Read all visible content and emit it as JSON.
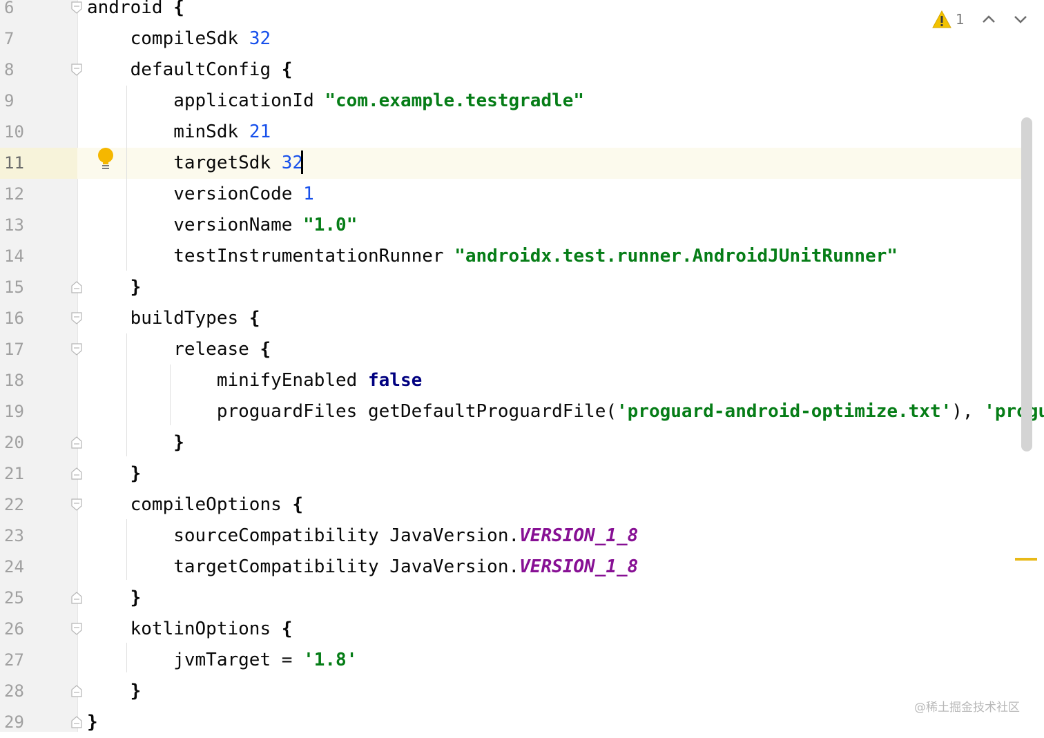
{
  "editor": {
    "lines": [
      {
        "n": "6",
        "fold": "open",
        "tokens": [
          {
            "t": "android ",
            "c": ""
          },
          {
            "t": "{",
            "c": "brace"
          }
        ]
      },
      {
        "n": "7",
        "fold": "",
        "tokens": [
          {
            "t": "    compileSdk ",
            "c": ""
          },
          {
            "t": "32",
            "c": "num"
          }
        ]
      },
      {
        "n": "8",
        "fold": "open",
        "tokens": [
          {
            "t": "    defaultConfig ",
            "c": ""
          },
          {
            "t": "{",
            "c": "brace"
          }
        ]
      },
      {
        "n": "9",
        "fold": "",
        "tokens": [
          {
            "t": "        applicationId ",
            "c": ""
          },
          {
            "t": "\"com.example.testgradle\"",
            "c": "str"
          }
        ]
      },
      {
        "n": "10",
        "fold": "",
        "tokens": [
          {
            "t": "        minSdk ",
            "c": ""
          },
          {
            "t": "21",
            "c": "num"
          }
        ]
      },
      {
        "n": "11",
        "fold": "",
        "current": true,
        "tokens": [
          {
            "t": "        targetSdk ",
            "c": ""
          },
          {
            "t": "32",
            "c": "num"
          }
        ]
      },
      {
        "n": "12",
        "fold": "",
        "tokens": [
          {
            "t": "        versionCode ",
            "c": ""
          },
          {
            "t": "1",
            "c": "num"
          }
        ]
      },
      {
        "n": "13",
        "fold": "",
        "tokens": [
          {
            "t": "        versionName ",
            "c": ""
          },
          {
            "t": "\"1.0\"",
            "c": "str"
          }
        ]
      },
      {
        "n": "14",
        "fold": "",
        "tokens": [
          {
            "t": "        testInstrumentationRunner ",
            "c": ""
          },
          {
            "t": "\"androidx.test.runner.AndroidJUnitRunner\"",
            "c": "str"
          }
        ]
      },
      {
        "n": "15",
        "fold": "close",
        "tokens": [
          {
            "t": "    ",
            "c": ""
          },
          {
            "t": "}",
            "c": "brace"
          }
        ]
      },
      {
        "n": "16",
        "fold": "open",
        "tokens": [
          {
            "t": "    buildTypes ",
            "c": ""
          },
          {
            "t": "{",
            "c": "brace"
          }
        ]
      },
      {
        "n": "17",
        "fold": "open",
        "tokens": [
          {
            "t": "        release ",
            "c": ""
          },
          {
            "t": "{",
            "c": "brace"
          }
        ]
      },
      {
        "n": "18",
        "fold": "",
        "tokens": [
          {
            "t": "            minifyEnabled ",
            "c": ""
          },
          {
            "t": "false",
            "c": "kwdark"
          }
        ]
      },
      {
        "n": "19",
        "fold": "",
        "tokens": [
          {
            "t": "            proguardFiles getDefaultProguardFile(",
            "c": ""
          },
          {
            "t": "'proguard-android-optimize.txt'",
            "c": "str"
          },
          {
            "t": "), ",
            "c": ""
          },
          {
            "t": "'progu",
            "c": "str"
          }
        ]
      },
      {
        "n": "20",
        "fold": "close",
        "tokens": [
          {
            "t": "        ",
            "c": ""
          },
          {
            "t": "}",
            "c": "brace"
          }
        ]
      },
      {
        "n": "21",
        "fold": "close",
        "tokens": [
          {
            "t": "    ",
            "c": ""
          },
          {
            "t": "}",
            "c": "brace"
          }
        ]
      },
      {
        "n": "22",
        "fold": "open",
        "tokens": [
          {
            "t": "    compileOptions ",
            "c": ""
          },
          {
            "t": "{",
            "c": "brace"
          }
        ]
      },
      {
        "n": "23",
        "fold": "",
        "tokens": [
          {
            "t": "        sourceCompatibility JavaVersion.",
            "c": ""
          },
          {
            "t": "VERSION_1_8",
            "c": "const"
          }
        ]
      },
      {
        "n": "24",
        "fold": "",
        "tokens": [
          {
            "t": "        targetCompatibility JavaVersion.",
            "c": ""
          },
          {
            "t": "VERSION_1_8",
            "c": "const"
          }
        ]
      },
      {
        "n": "25",
        "fold": "close",
        "tokens": [
          {
            "t": "    ",
            "c": ""
          },
          {
            "t": "}",
            "c": "brace"
          }
        ]
      },
      {
        "n": "26",
        "fold": "open",
        "tokens": [
          {
            "t": "    kotlinOptions ",
            "c": ""
          },
          {
            "t": "{",
            "c": "brace"
          }
        ]
      },
      {
        "n": "27",
        "fold": "",
        "tokens": [
          {
            "t": "        jvmTarget = ",
            "c": ""
          },
          {
            "t": "'1.8'",
            "c": "str"
          }
        ]
      },
      {
        "n": "28",
        "fold": "close",
        "tokens": [
          {
            "t": "    ",
            "c": ""
          },
          {
            "t": "}",
            "c": "brace"
          }
        ]
      },
      {
        "n": "29",
        "fold": "close",
        "tokens": [
          {
            "t": "}",
            "c": "brace"
          }
        ]
      }
    ]
  },
  "inspection": {
    "icon": "warning-icon",
    "count": "1",
    "prev_icon": "chevron-up-icon",
    "next_icon": "chevron-down-icon"
  },
  "intention_icon": "lightbulb-icon",
  "watermark": "@稀土掘金技术社区",
  "colors": {
    "number": "#1750eb",
    "string": "#067d17",
    "keyword": "#000080",
    "constant": "#871094",
    "current_line": "#fcfaed",
    "warning": "#e8b918"
  }
}
